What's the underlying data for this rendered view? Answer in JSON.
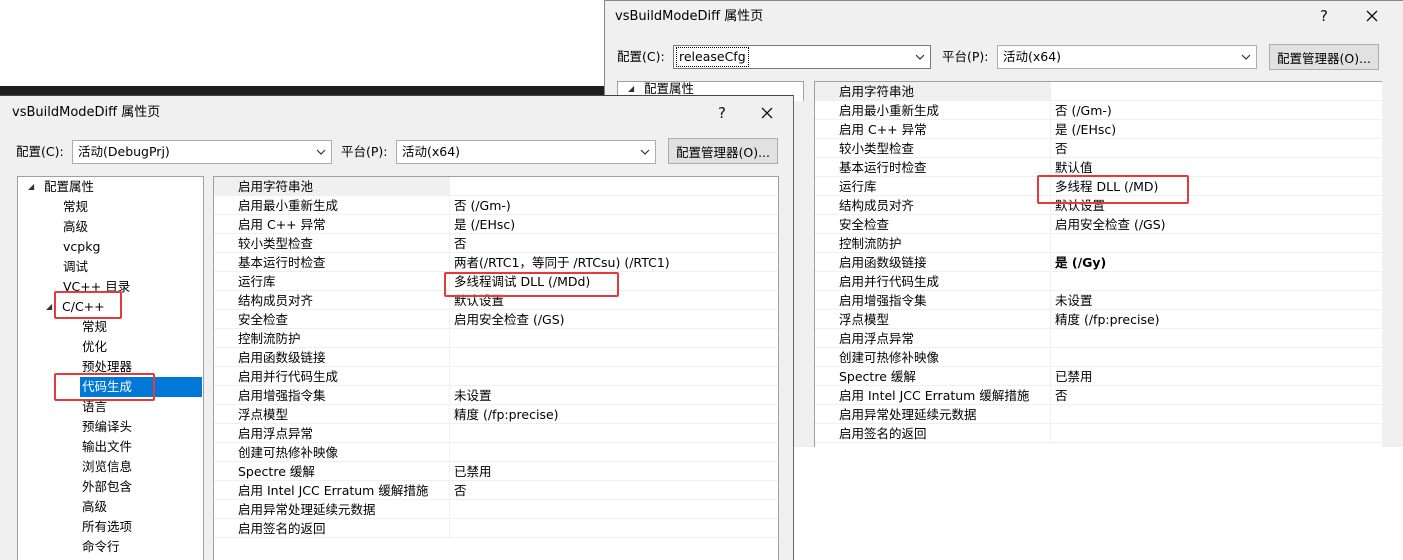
{
  "front": {
    "title": "vsBuildModeDiff 属性页",
    "help_glyph": "?",
    "close_glyph": "✕",
    "config_label": "配置(C):",
    "config_value": "活动(DebugPrj)",
    "platform_label": "平台(P):",
    "platform_value": "活动(x64)",
    "manager_button": "配置管理器(O)...",
    "tree": [
      {
        "label": "配置属性",
        "expanded": true
      },
      {
        "label": "常规"
      },
      {
        "label": "高级"
      },
      {
        "label": "vcpkg"
      },
      {
        "label": "调试"
      },
      {
        "label": "VC++ 目录"
      },
      {
        "label": "C/C++",
        "expanded": true
      },
      {
        "label": "常规"
      },
      {
        "label": "优化"
      },
      {
        "label": "预处理器"
      },
      {
        "label": "代码生成",
        "selected": true
      },
      {
        "label": "语言"
      },
      {
        "label": "预编译头"
      },
      {
        "label": "输出文件"
      },
      {
        "label": "浏览信息"
      },
      {
        "label": "外部包含"
      },
      {
        "label": "高级"
      },
      {
        "label": "所有选项"
      },
      {
        "label": "命令行"
      }
    ],
    "properties": [
      {
        "name": "启用字符串池",
        "value": ""
      },
      {
        "name": "启用最小重新生成",
        "value": "否 (/Gm-)"
      },
      {
        "name": "启用 C++ 异常",
        "value": "是 (/EHsc)"
      },
      {
        "name": "较小类型检查",
        "value": "否"
      },
      {
        "name": "基本运行时检查",
        "value": "两者(/RTC1，等同于 /RTCsu) (/RTC1)"
      },
      {
        "name": "运行库",
        "value": "多线程调试 DLL (/MDd)"
      },
      {
        "name": "结构成员对齐",
        "value": "默认设置"
      },
      {
        "name": "安全检查",
        "value": "启用安全检查 (/GS)"
      },
      {
        "name": "控制流防护",
        "value": ""
      },
      {
        "name": "启用函数级链接",
        "value": ""
      },
      {
        "name": "启用并行代码生成",
        "value": ""
      },
      {
        "name": "启用增强指令集",
        "value": "未设置"
      },
      {
        "name": "浮点模型",
        "value": "精度 (/fp:precise)"
      },
      {
        "name": "启用浮点异常",
        "value": ""
      },
      {
        "name": "创建可热修补映像",
        "value": ""
      },
      {
        "name": "Spectre 缓解",
        "value": "已禁用"
      },
      {
        "name": "启用 Intel JCC Erratum 缓解措施",
        "value": "否"
      },
      {
        "name": "启用异常处理延续元数据",
        "value": ""
      },
      {
        "name": "启用签名的返回",
        "value": ""
      }
    ]
  },
  "back": {
    "title": "vsBuildModeDiff 属性页",
    "help_glyph": "?",
    "close_glyph": "✕",
    "config_label": "配置(C):",
    "config_value": "releaseCfg",
    "platform_label": "平台(P):",
    "platform_value": "活动(x64)",
    "manager_button": "配置管理器(O)...",
    "tree_top": "配置属性",
    "properties": [
      {
        "name": "启用字符串池",
        "value": ""
      },
      {
        "name": "启用最小重新生成",
        "value": "否 (/Gm-)"
      },
      {
        "name": "启用 C++ 异常",
        "value": "是 (/EHsc)"
      },
      {
        "name": "较小类型检查",
        "value": "否"
      },
      {
        "name": "基本运行时检查",
        "value": "默认值"
      },
      {
        "name": "运行库",
        "value": "多线程 DLL (/MD)"
      },
      {
        "name": "结构成员对齐",
        "value": "默认设置"
      },
      {
        "name": "安全检查",
        "value": "启用安全检查 (/GS)"
      },
      {
        "name": "控制流防护",
        "value": ""
      },
      {
        "name": "启用函数级链接",
        "value": "是 (/Gy)",
        "bold": true
      },
      {
        "name": "启用并行代码生成",
        "value": ""
      },
      {
        "name": "启用增强指令集",
        "value": "未设置"
      },
      {
        "name": "浮点模型",
        "value": "精度 (/fp:precise)"
      },
      {
        "name": "启用浮点异常",
        "value": ""
      },
      {
        "name": "创建可热修补映像",
        "value": ""
      },
      {
        "name": "Spectre 缓解",
        "value": "已禁用"
      },
      {
        "name": "启用 Intel JCC Erratum 缓解措施",
        "value": "否"
      },
      {
        "name": "启用异常处理延续元数据",
        "value": ""
      },
      {
        "name": "启用签名的返回",
        "value": ""
      }
    ]
  },
  "colors": {
    "highlight_box": "#e23b3b",
    "selection": "#0078d7",
    "dialog_bg": "#f0f0f0"
  },
  "icons": [
    "help-icon",
    "close-icon",
    "dropdown-arrow-icon",
    "tree-expand-icon"
  ]
}
